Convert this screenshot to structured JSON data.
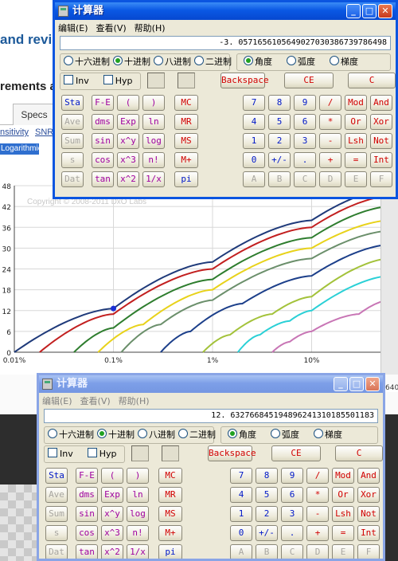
{
  "webpage": {
    "title_fragment": "and revi",
    "subtitle_fragment": "rements an",
    "tab_label": "Specs",
    "links": [
      "nsitivity",
      "SNR"
    ],
    "selected_item": "Logarithmic",
    "watermark": "Copyright © 2008-2011 DxO Labs",
    "side_fragment": "640"
  },
  "chart_data": {
    "type": "line",
    "title": "",
    "xlabel": "",
    "ylabel": "",
    "x_scale": "log",
    "x_ticks": [
      "0.01%",
      "0.1%",
      "1%",
      "10%"
    ],
    "y_ticks": [
      "0",
      "6",
      "12",
      "18",
      "24",
      "30",
      "36",
      "42",
      "48"
    ],
    "ylim": [
      0,
      48
    ],
    "grid": true,
    "series": [
      {
        "color": "#1f3a7a",
        "points": [
          [
            0.01,
            0
          ],
          [
            0.1,
            12.6
          ],
          [
            1,
            26
          ],
          [
            10,
            38
          ],
          [
            60,
            47
          ]
        ]
      },
      {
        "color": "#c21f1f",
        "points": [
          [
            0.018,
            0
          ],
          [
            0.1,
            11
          ],
          [
            1,
            24
          ],
          [
            10,
            36
          ],
          [
            60,
            45
          ]
        ]
      },
      {
        "color": "#2e7d2e",
        "points": [
          [
            0.04,
            0
          ],
          [
            0.1,
            7
          ],
          [
            1,
            21
          ],
          [
            10,
            33
          ],
          [
            60,
            42
          ]
        ]
      },
      {
        "color": "#e8d21a",
        "points": [
          [
            0.07,
            0
          ],
          [
            0.2,
            8
          ],
          [
            1,
            18
          ],
          [
            10,
            30
          ],
          [
            60,
            38
          ]
        ]
      },
      {
        "color": "#6b8f6b",
        "points": [
          [
            0.12,
            0
          ],
          [
            0.3,
            8
          ],
          [
            1,
            15
          ],
          [
            10,
            27
          ],
          [
            60,
            35
          ]
        ]
      },
      {
        "color": "#1c3f8a",
        "points": [
          [
            0.3,
            0
          ],
          [
            0.6,
            6
          ],
          [
            2,
            14
          ],
          [
            10,
            22
          ],
          [
            60,
            31
          ]
        ]
      },
      {
        "color": "#a3c23a",
        "points": [
          [
            0.8,
            0
          ],
          [
            1.5,
            5
          ],
          [
            4,
            11
          ],
          [
            10,
            16
          ],
          [
            60,
            27
          ]
        ]
      },
      {
        "color": "#2ad0d6",
        "points": [
          [
            1.8,
            0
          ],
          [
            3,
            5
          ],
          [
            6,
            9
          ],
          [
            10,
            12
          ],
          [
            60,
            22
          ]
        ]
      },
      {
        "color": "#c875b5",
        "points": [
          [
            4,
            0
          ],
          [
            6,
            3
          ],
          [
            10,
            6
          ],
          [
            30,
            11
          ],
          [
            60,
            15
          ]
        ]
      }
    ],
    "highlight_point": {
      "x": 0.1,
      "y": 12.6,
      "color": "#1b2fd6"
    }
  },
  "calc_top": {
    "title": "计算器",
    "menu": [
      "编辑(E)",
      "查看(V)",
      "帮助(H)"
    ],
    "display": "-3. 0571656105649027030386739786498",
    "radix": [
      "十六进制",
      "十进制",
      "八进制",
      "二进制"
    ],
    "radix_selected": 1,
    "angle": [
      "角度",
      "弧度",
      "梯度"
    ],
    "angle_selected": 0,
    "inv": "Inv",
    "hyp": "Hyp",
    "row_backspace": [
      "Backspace",
      "CE",
      "C"
    ],
    "stat": [
      "Sta",
      "Ave",
      "Sum",
      "s",
      "Dat"
    ],
    "sci": [
      [
        "F-E",
        "(",
        ")"
      ],
      [
        "dms",
        "Exp",
        "ln"
      ],
      [
        "sin",
        "x^y",
        "log"
      ],
      [
        "cos",
        "x^3",
        "n!"
      ],
      [
        "tan",
        "x^2",
        "1/x"
      ]
    ],
    "mem": [
      "MC",
      "MR",
      "MS",
      "M+",
      "pi"
    ],
    "pad": [
      [
        "7",
        "8",
        "9",
        "/",
        "Mod",
        "And"
      ],
      [
        "4",
        "5",
        "6",
        "*",
        "Or",
        "Xor"
      ],
      [
        "1",
        "2",
        "3",
        "-",
        "Lsh",
        "Not"
      ],
      [
        "0",
        "+/-",
        ".",
        "+",
        "=",
        "Int"
      ],
      [
        "A",
        "B",
        "C",
        "D",
        "E",
        "F"
      ]
    ]
  },
  "calc_bottom": {
    "title": "计算器",
    "menu": [
      "编辑(E)",
      "查看(V)",
      "帮助(H)"
    ],
    "display": "12. 632766845194896241310185501183",
    "radix": [
      "十六进制",
      "十进制",
      "八进制",
      "二进制"
    ],
    "radix_selected": 1,
    "angle": [
      "角度",
      "弧度",
      "梯度"
    ],
    "angle_selected": 0,
    "inv": "Inv",
    "hyp": "Hyp",
    "row_backspace": [
      "Backspace",
      "CE",
      "C"
    ],
    "stat": [
      "Sta",
      "Ave",
      "Sum",
      "s",
      "Dat"
    ],
    "sci": [
      [
        "F-E",
        "(",
        ")"
      ],
      [
        "dms",
        "Exp",
        "ln"
      ],
      [
        "sin",
        "x^y",
        "log"
      ],
      [
        "cos",
        "x^3",
        "n!"
      ],
      [
        "tan",
        "x^2",
        "1/x"
      ]
    ],
    "mem": [
      "MC",
      "MR",
      "MS",
      "M+",
      "pi"
    ],
    "pad": [
      [
        "7",
        "8",
        "9",
        "/",
        "Mod",
        "And"
      ],
      [
        "4",
        "5",
        "6",
        "*",
        "Or",
        "Xor"
      ],
      [
        "1",
        "2",
        "3",
        "-",
        "Lsh",
        "Not"
      ],
      [
        "0",
        "+/-",
        ".",
        "+",
        "=",
        "Int"
      ],
      [
        "A",
        "B",
        "C",
        "D",
        "E",
        "F"
      ]
    ]
  }
}
